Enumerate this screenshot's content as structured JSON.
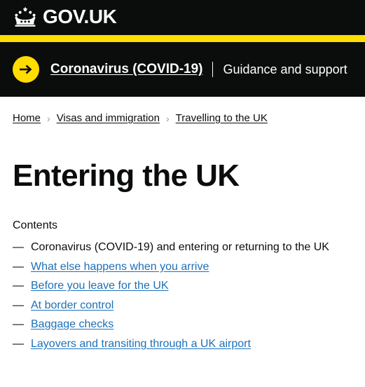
{
  "header": {
    "logotype": "GOV.UK",
    "crown_icon": "crown-icon"
  },
  "colors": {
    "black": "#0b0c0c",
    "yellow": "#ffdd00",
    "link_blue": "#1d70b8",
    "breadcrumb_separator": "#959a9c",
    "white": "#ffffff"
  },
  "covid_banner": {
    "arrow_icon": "arrow-right-icon",
    "link_label": "Coronavirus (COVID-19)",
    "subtext": "Guidance and support"
  },
  "breadcrumbs": {
    "separator": "›",
    "items": [
      {
        "label": "Home"
      },
      {
        "label": "Visas and immigration"
      },
      {
        "label": "Travelling to the UK"
      }
    ]
  },
  "main": {
    "title": "Entering the UK",
    "contents": {
      "heading": "Contents",
      "dash": "—",
      "items": [
        {
          "label": "Coronavirus (COVID-19) and entering or returning to the UK",
          "current": true
        },
        {
          "label": "What else happens when you arrive",
          "current": false
        },
        {
          "label": "Before you leave for the UK",
          "current": false
        },
        {
          "label": "At border control",
          "current": false
        },
        {
          "label": "Baggage checks",
          "current": false
        },
        {
          "label": "Layovers and transiting through a UK airport",
          "current": false
        }
      ]
    }
  }
}
